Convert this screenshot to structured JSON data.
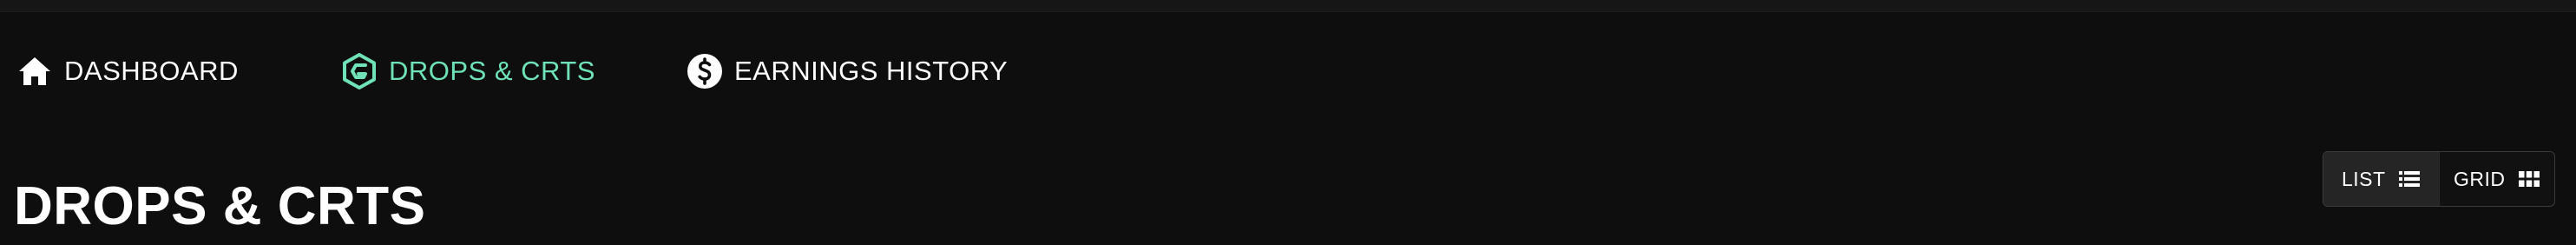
{
  "nav": {
    "items": [
      {
        "label": "DASHBOARD",
        "icon": "home-icon",
        "active": false
      },
      {
        "label": "DROPS & CRTS",
        "icon": "drops-logo-icon",
        "active": true
      },
      {
        "label": "EARNINGS HISTORY",
        "icon": "dollar-circle-icon",
        "active": false
      }
    ]
  },
  "page": {
    "title": "DROPS & CRTS"
  },
  "view_toggle": {
    "list_label": "LIST",
    "grid_label": "GRID",
    "list_icon": "list-icon",
    "grid_icon": "grid-icon",
    "selected": "list"
  },
  "colors": {
    "background": "#0e0e0e",
    "text": "#ffffff",
    "accent": "#6fe3b7"
  }
}
